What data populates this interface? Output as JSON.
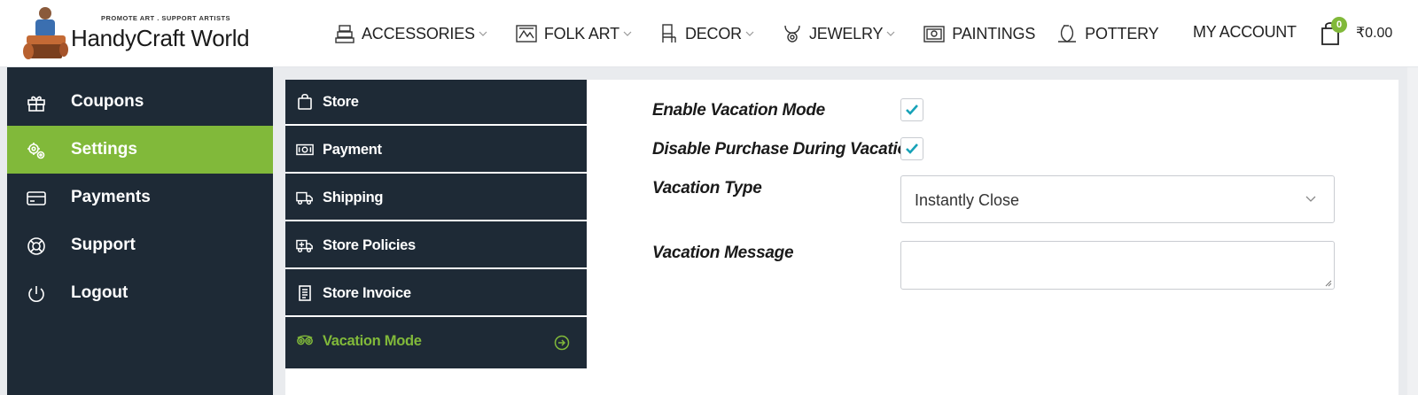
{
  "header": {
    "logo_tagline": "PROMOTE ART . SUPPORT ARTISTS",
    "logo_brand": "HandyCraft World",
    "nav": [
      {
        "label": "ACCESSORIES",
        "icon": "accessories-icon",
        "dropdown": true
      },
      {
        "label": "FOLK ART",
        "icon": "folk-art-icon",
        "dropdown": true
      },
      {
        "label": "DECOR",
        "icon": "decor-icon",
        "dropdown": true
      },
      {
        "label": "JEWELRY",
        "icon": "jewelry-icon",
        "dropdown": true
      },
      {
        "label": "PAINTINGS",
        "icon": "paintings-icon",
        "dropdown": false
      },
      {
        "label": "POTTERY",
        "icon": "pottery-icon",
        "dropdown": false
      }
    ],
    "account_label": "MY ACCOUNT",
    "cart_count": "0",
    "cart_total": "₹0.00"
  },
  "sidebar": {
    "items": [
      {
        "label": "Coupons",
        "icon": "gift-icon"
      },
      {
        "label": "Settings",
        "icon": "gears-icon",
        "active": true
      },
      {
        "label": "Payments",
        "icon": "credit-card-icon"
      },
      {
        "label": "Support",
        "icon": "lifebuoy-icon"
      },
      {
        "label": "Logout",
        "icon": "power-icon"
      }
    ]
  },
  "settings_tabs": {
    "items": [
      {
        "label": "Store",
        "icon": "bag-icon"
      },
      {
        "label": "Payment",
        "icon": "money-icon"
      },
      {
        "label": "Shipping",
        "icon": "truck-icon"
      },
      {
        "label": "Store Policies",
        "icon": "policy-truck-icon"
      },
      {
        "label": "Store Invoice",
        "icon": "invoice-icon"
      },
      {
        "label": "Vacation Mode",
        "icon": "vacation-icon",
        "active": true
      }
    ]
  },
  "form": {
    "enable_vacation_label": "Enable Vacation Mode",
    "enable_vacation_checked": true,
    "disable_purchase_label": "Disable Purchase During Vacation",
    "disable_purchase_checked": true,
    "vacation_type_label": "Vacation Type",
    "vacation_type_value": "Instantly Close",
    "vacation_message_label": "Vacation Message",
    "vacation_message_value": ""
  },
  "colors": {
    "accent": "#81b93a",
    "sidebar_bg": "#1e2a36",
    "check": "#17a2b8"
  }
}
